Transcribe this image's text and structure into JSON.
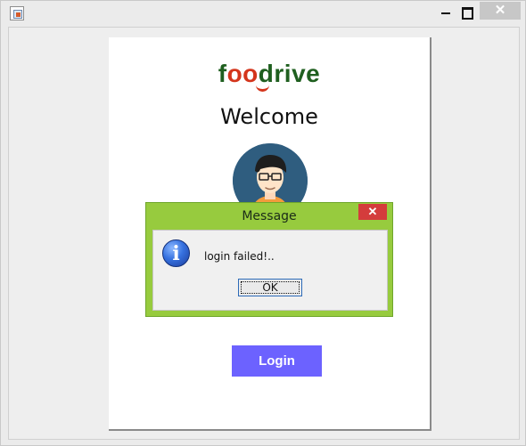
{
  "window": {
    "controls": {
      "minimize_icon": "minimize-icon",
      "maximize_icon": "maximize-icon",
      "close_label": "✕"
    }
  },
  "card": {
    "brand_prefix": "f",
    "brand_accent": "oo",
    "brand_suffix": "drive",
    "welcome": "Welcome",
    "login_label": "Login",
    "colors": {
      "brand_green": "#1f5f1f",
      "brand_red": "#d4351c",
      "login_bg": "#6c62ff"
    }
  },
  "dialog": {
    "title": "Message",
    "close_label": "✕",
    "message": "login failed!..",
    "ok_label": "OK",
    "icon": "info-icon",
    "colors": {
      "frame": "#97cb3e",
      "close": "#d43c3c"
    }
  }
}
